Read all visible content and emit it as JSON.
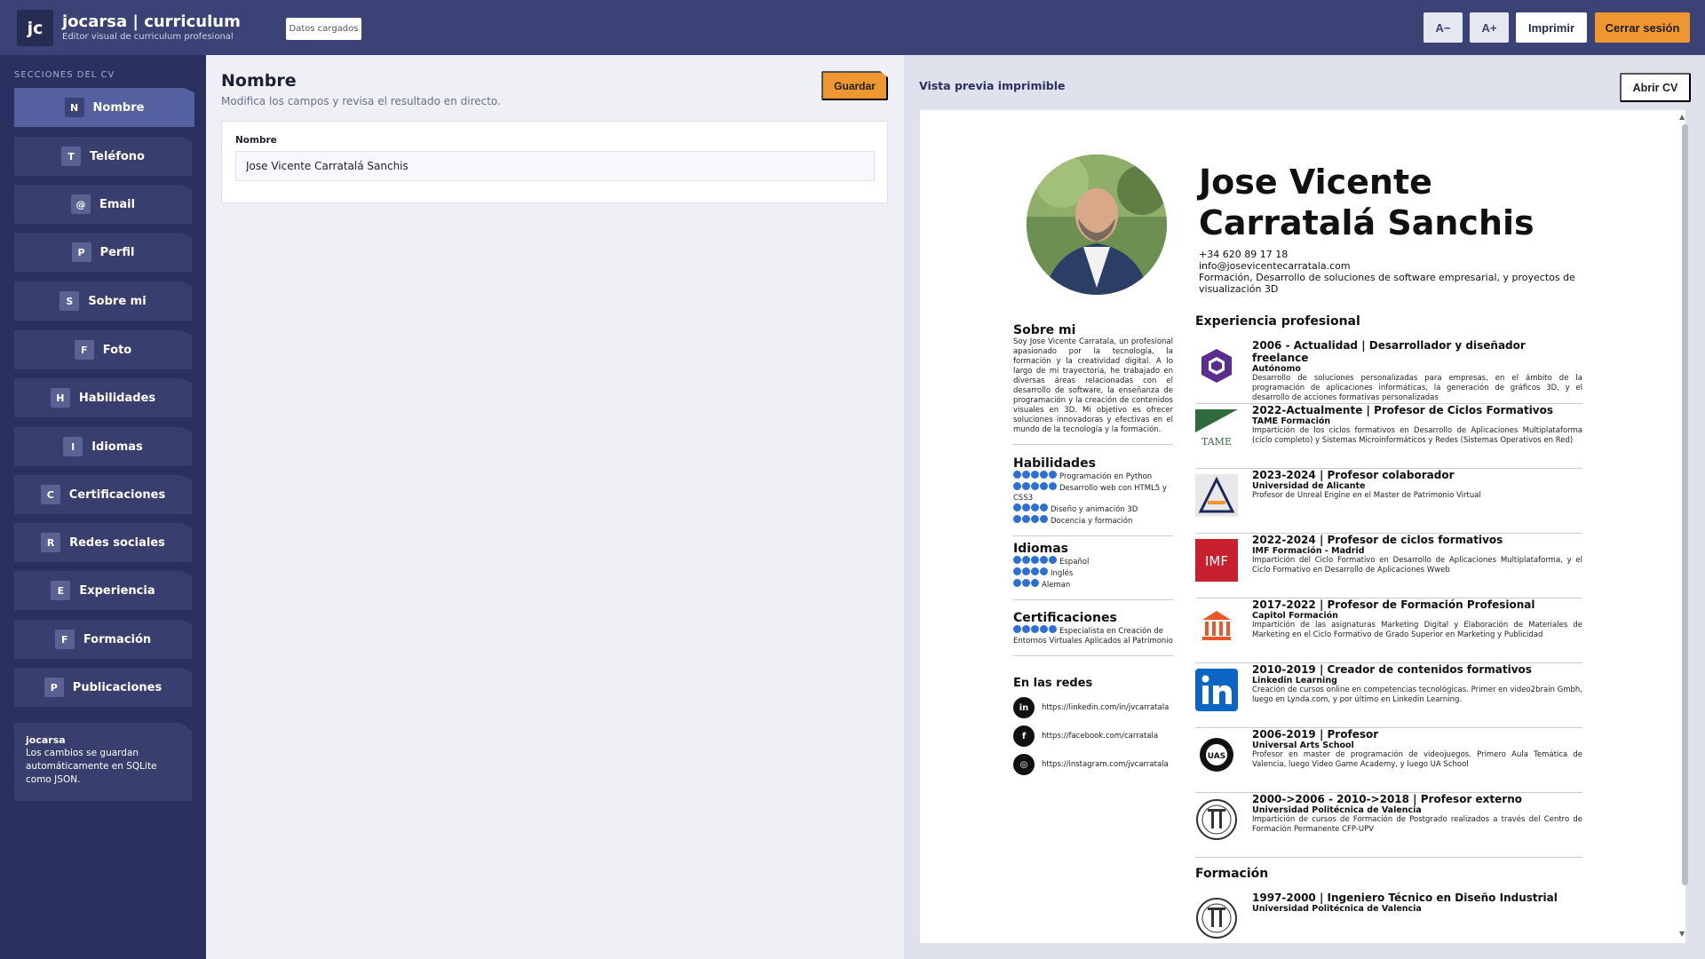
{
  "header": {
    "logo_text": "jc",
    "title": "jocarsa | curriculum",
    "subtitle": "Editor visual de curriculum profesional",
    "status": "Datos cargados",
    "font_smaller": "A−",
    "font_larger": "A+",
    "print": "Imprimir",
    "logout": "Cerrar sesión"
  },
  "sidebar": {
    "heading": "SECCIONES DEL CV",
    "items": [
      {
        "key": "N",
        "label": "Nombre"
      },
      {
        "key": "T",
        "label": "Teléfono"
      },
      {
        "key": "@",
        "label": "Email"
      },
      {
        "key": "P",
        "label": "Perfil"
      },
      {
        "key": "S",
        "label": "Sobre mi"
      },
      {
        "key": "F",
        "label": "Foto"
      },
      {
        "key": "H",
        "label": "Habilidades"
      },
      {
        "key": "I",
        "label": "Idiomas"
      },
      {
        "key": "C",
        "label": "Certificaciones"
      },
      {
        "key": "R",
        "label": "Redes sociales"
      },
      {
        "key": "E",
        "label": "Experiencia"
      },
      {
        "key": "F",
        "label": "Formación"
      },
      {
        "key": "P",
        "label": "Publicaciones"
      }
    ],
    "info_title": "jocarsa",
    "info_text": "Los cambios se guardan automáticamente en SQLite como JSON."
  },
  "editor": {
    "title": "Nombre",
    "subtitle": "Modifica los campos y revisa el resultado en directo.",
    "save": "Guardar",
    "field_label": "Nombre",
    "field_value": "Jose Vicente Carratalá Sanchis"
  },
  "preview": {
    "label": "Vista previa imprimible",
    "open": "Abrir CV",
    "name_line1": "Jose Vicente",
    "name_line2": "Carratalá Sanchis",
    "phone": "+34 620 89 17 18",
    "email": "info@josevicentecarratala.com",
    "profile": "Formación, Desarrollo de soluciones de software empresarial, y proyectos de visualización 3D",
    "about_title": "Sobre mi",
    "about_text": "Soy Jose Vicente Carratala, un profesional apasionado por la tecnología, la formación y la creatividad digital. A lo largo de mi trayectoria, he trabajado en diversas áreas relacionadas con el desarrollo de software, la enseñanza de programación y la creación de contenidos visuales en 3D. Mi objetivo es ofrecer soluciones innovadoras y efectivas en el mundo de la tecnología y la formación.",
    "skills_title": "Habilidades",
    "skills": [
      {
        "level": 5,
        "name": "Programación en Python"
      },
      {
        "level": 5,
        "name": "Desarrollo web con HTML5 y CSS3"
      },
      {
        "level": 4,
        "name": "Diseño y animación 3D"
      },
      {
        "level": 4,
        "name": "Docencia y formación"
      }
    ],
    "languages_title": "Idiomas",
    "languages": [
      {
        "level": 5,
        "name": "Español"
      },
      {
        "level": 4,
        "name": "Inglés"
      },
      {
        "level": 3,
        "name": "Aleman"
      }
    ],
    "certs_title": "Certificaciones",
    "certs": [
      {
        "level": 5,
        "name": "Especialista en Creación de Entornos Virtuales Aplicados al Patrimonio"
      }
    ],
    "social_title": "En las redes",
    "social": [
      {
        "icon": "linkedin-icon",
        "glyph": "in",
        "url": "https://linkedin.com/in/jvcarratala"
      },
      {
        "icon": "facebook-icon",
        "glyph": "f",
        "url": "https://facebook.com/carratala"
      },
      {
        "icon": "instagram-icon",
        "glyph": "◎",
        "url": "https://instagram.com/jvcarratala"
      }
    ],
    "experience_title": "Experiencia profesional",
    "experience": [
      {
        "title": "2006 - Actualidad | Desarrollador y diseñador freelance",
        "org": "Autónomo",
        "desc": "Desarrollo de soluciones personalizadas para empresas, en el ámbito de la programación de aplicaciones informáticas, la generación de gráficos 3D, y el desarrollo de acciones formativas personalizadas",
        "logo": "hexagon-logo"
      },
      {
        "title": "2022-Actualmente | Profesor de Ciclos Formativos",
        "org": "TAME Formación",
        "desc": "Impartición de los ciclos formativos en Desarrollo de Aplicaciones Multiplataforma (ciclo completo) y Sistemas Microinformáticos y Redes (Sistemas Operativos en Red)",
        "logo": "tame-logo"
      },
      {
        "title": "2023-2024 | Profesor colaborador",
        "org": "Universidad de Alicante",
        "desc": "Profesor de Unreal Engine en el Master de Patrimonio Virtual",
        "logo": "ua-logo"
      },
      {
        "title": "2022-2024 | Profesor de ciclos formativos",
        "org": "IMF Formación - Madrid",
        "desc": "Impartición del Ciclo Formativo en Desarrollo de Aplicaciones Multiplataforma, y el Ciclo Formativo en Desarrollo de Aplicaciones Wweb",
        "logo": "imf-logo"
      },
      {
        "title": "2017-2022 | Profesor de Formación Profesional",
        "org": "Capitol Formación",
        "desc": "Impartición de las asignaturas Marketing Digital y Elaboración de Materiales de Marketing en el Ciclo Formativo de Grado Superior en Marketing y Publicidad",
        "logo": "capitol-logo"
      },
      {
        "title": "2010-2019 | Creador de contenidos formativos",
        "org": "Linkedin Learning",
        "desc": "Creación de cursos online en competencias tecnológicas. Primer en video2brain Gmbh, luego en Lynda.com, y por último en Linkedin Learning.",
        "logo": "linkedin-logo"
      },
      {
        "title": "2006-2019 | Profesor",
        "org": "Universal Arts School",
        "desc": "Profesor en master de programación de videojuegos. Primero Aula Temática de Valencia, luego Video Game Academy, y luego UA School",
        "logo": "uas-logo"
      },
      {
        "title": "2000->2006 - 2010->2018 | Profesor externo",
        "org": "Universidad Politécnica de Valencia",
        "desc": "Impartición de cursos de Formación de Postgrado realizados a través del Centro de Formación Permanente CFP-UPV",
        "logo": "upv-logo"
      }
    ],
    "education_title": "Formación",
    "education": [
      {
        "title": "1997-2000 | Ingeniero Técnico en Diseño Industrial",
        "org": "Universidad Politécnica de Valencia",
        "logo": "upv-logo"
      }
    ],
    "logo_text": {
      "tame": "TAME",
      "imf": "IMF",
      "uas": "UAS"
    },
    "colors": {
      "accent": "#ee9630",
      "dots": "#2c6fd6",
      "topbar": "#3b4376",
      "sidebar": "#2a3060"
    }
  }
}
